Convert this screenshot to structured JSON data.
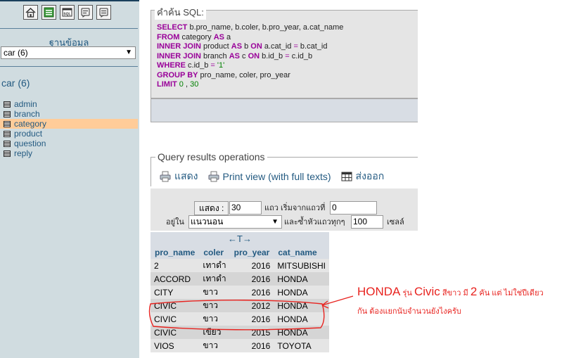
{
  "nav": {
    "icons": [
      "home-icon",
      "query-window-icon",
      "sql-icon",
      "docs-icon",
      "help-icon"
    ],
    "database_label": "ฐานข้อมูล",
    "database_selected": "car (6)",
    "database_name": "car (6)",
    "tables": [
      "admin",
      "branch",
      "category",
      "product",
      "question",
      "reply"
    ],
    "active_table": "category"
  },
  "sql_box": {
    "legend": "คำค้น SQL:",
    "lines": [
      [
        {
          "t": "kw",
          "v": "SELECT"
        },
        {
          "t": "txt",
          "v": " b.pro_name, b.coler, b.pro_year, a.cat_name"
        }
      ],
      [
        {
          "t": "kw",
          "v": "FROM"
        },
        {
          "t": "txt",
          "v": " category "
        },
        {
          "t": "kw",
          "v": "AS"
        },
        {
          "t": "txt",
          "v": " a"
        }
      ],
      [
        {
          "t": "kw",
          "v": "INNER JOIN"
        },
        {
          "t": "txt",
          "v": " product "
        },
        {
          "t": "kw",
          "v": "AS"
        },
        {
          "t": "txt",
          "v": " b "
        },
        {
          "t": "kw",
          "v": "ON"
        },
        {
          "t": "txt",
          "v": " a.cat_id "
        },
        {
          "t": "op",
          "v": "="
        },
        {
          "t": "txt",
          "v": " b.cat_id"
        }
      ],
      [
        {
          "t": "kw",
          "v": "INNER JOIN"
        },
        {
          "t": "txt",
          "v": " branch "
        },
        {
          "t": "kw",
          "v": "AS"
        },
        {
          "t": "txt",
          "v": " c "
        },
        {
          "t": "kw",
          "v": "ON"
        },
        {
          "t": "txt",
          "v": " b.id_b "
        },
        {
          "t": "op",
          "v": "="
        },
        {
          "t": "txt",
          "v": " c.id_b"
        }
      ],
      [
        {
          "t": "kw",
          "v": "WHERE"
        },
        {
          "t": "txt",
          "v": " c.id_b "
        },
        {
          "t": "op",
          "v": "="
        },
        {
          "t": "str",
          "v": " '1'"
        }
      ],
      [
        {
          "t": "kw",
          "v": "GROUP BY"
        },
        {
          "t": "txt",
          "v": " pro_name, coler, pro_year"
        }
      ],
      [
        {
          "t": "kw",
          "v": "LIMIT"
        },
        {
          "t": "num",
          "v": " 0"
        },
        {
          "t": "txt",
          "v": " , "
        },
        {
          "t": "num",
          "v": "30"
        }
      ]
    ]
  },
  "ops": {
    "legend": "Query results operations",
    "show_label": "แสดง",
    "print_label": "Print view (with full texts)",
    "export_label": "ส่งออก"
  },
  "navform": {
    "show_button": "แสดง :",
    "rows_value": "30",
    "rows_from_label": "แถว เริ่มจากแถวที่",
    "start_value": "0",
    "in_label": "อยู่ใน",
    "mode_value": "แนวนอน",
    "repeat_label": "และซ้ำหัวแถวทุกๆ",
    "repeat_value": "100",
    "cells_label": "เซลล์"
  },
  "results": {
    "sort_arrows": "←T→",
    "columns": [
      "pro_name",
      "coler",
      "pro_year",
      "cat_name"
    ],
    "rows": [
      [
        "2",
        "เทาดำ",
        "2016",
        "MITSUBISHI"
      ],
      [
        "ACCORD",
        "เทาดำ",
        "2016",
        "HONDA"
      ],
      [
        "CITY",
        "ขาว",
        "2016",
        "HONDA"
      ],
      [
        "CIVIC",
        "ขาว",
        "2012",
        "HONDA"
      ],
      [
        "CIVIC",
        "ขาว",
        "2016",
        "HONDA"
      ],
      [
        "CIVIC",
        "เขียว",
        "2015",
        "HONDA"
      ],
      [
        "VIOS",
        "ขาว",
        "2016",
        "TOYOTA"
      ]
    ]
  },
  "annotation": {
    "line1_parts": [
      {
        "text": "HONDA",
        "big": true
      },
      {
        "text": " รุ่น ",
        "big": false
      },
      {
        "text": "Civic",
        "big": true
      },
      {
        "text": " สีขาว มี ",
        "big": false
      },
      {
        "text": "2",
        "big": true
      },
      {
        "text": " คัน แต่ ไม่ใช่ปีเดียว",
        "big": false
      }
    ],
    "line2": "กัน ต้องแยกนับจำนวนยังไงครับ",
    "color": "#e8231f"
  }
}
